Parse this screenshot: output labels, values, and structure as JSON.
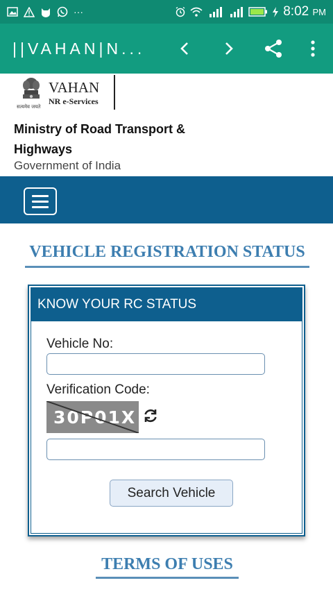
{
  "statusbar": {
    "time": "8:02",
    "ampm": "PM",
    "overflow": "···",
    "icons": [
      "gallery-icon",
      "warning-icon",
      "cat-icon",
      "whatsapp-icon",
      "alarm-icon",
      "wifi-icon",
      "signal-icon",
      "signal-4g-icon",
      "battery-icon"
    ]
  },
  "appbar": {
    "title": "||VAHAN|N...",
    "icons": [
      "back-chevron-icon",
      "forward-chevron-icon",
      "share-icon",
      "more-vertical-icon"
    ]
  },
  "header": {
    "logo_title": "VAHAN",
    "logo_subtitle": "NR e-Services",
    "emblem_caption": "सत्यमेव जयते",
    "ministry": "Ministry of Road Transport & Highways",
    "government": "Government of India"
  },
  "menu": {
    "icon": "hamburger-icon"
  },
  "main": {
    "section_title": "VEHICLE REGISTRATION STATUS",
    "card": {
      "header": "KNOW YOUR RC STATUS",
      "vehicle_no_label": "Vehicle No:",
      "vehicle_no_value": "",
      "verification_label": "Verification Code:",
      "captcha_text": "30P01X",
      "verification_value": "",
      "search_button": "Search Vehicle"
    },
    "terms_title": "TERMS OF USES"
  },
  "colors": {
    "statusbar": "#0f8a72",
    "appbar": "#129c80",
    "brand_blue": "#0e5f8e",
    "title_blue": "#3d7eb0"
  }
}
